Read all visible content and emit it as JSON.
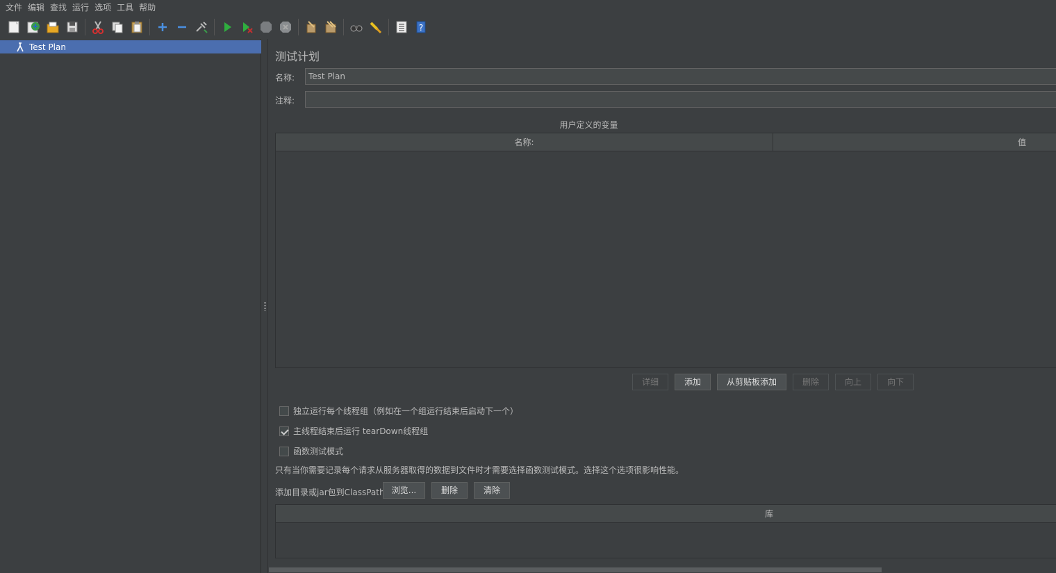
{
  "menu": [
    "文件",
    "编辑",
    "查找",
    "运行",
    "选项",
    "工具",
    "帮助"
  ],
  "toolbar": {
    "icons": [
      "new-icon",
      "templates-icon",
      "open-icon",
      "save-icon",
      "cut-icon",
      "copy-icon",
      "paste-icon",
      "expand-icon",
      "collapse-icon",
      "toggle-icon",
      "start-icon",
      "start-no-pause-icon",
      "stop-icon",
      "shutdown-icon",
      "clear-icon",
      "clear-all-icon",
      "search-icon",
      "reset-search-icon",
      "function-helper-icon",
      "help-icon"
    ]
  },
  "tree": {
    "selected_item": "Test Plan"
  },
  "main": {
    "title": "测试计划",
    "name_label": "名称:",
    "name_value": "Test Plan",
    "comment_label": "注释:",
    "comment_value": "",
    "variables_title": "用户定义的变量",
    "variables_columns": [
      "名称:",
      "值"
    ],
    "variables_rows": [],
    "buttons": {
      "detail": "详细",
      "add": "添加",
      "add_from_clipboard": "从剪贴板添加",
      "delete": "删除",
      "up": "向上",
      "down": "向下"
    },
    "options": [
      {
        "label": "独立运行每个线程组（例如在一个组运行结束后启动下一个）",
        "checked": false
      },
      {
        "label": "主线程结束后运行 tearDown线程组",
        "checked": true
      },
      {
        "label": "函数测试模式",
        "checked": false
      }
    ],
    "functional_note": "只有当你需要记录每个请求从服务器取得的数据到文件时才需要选择函数测试模式。选择这个选项很影响性能。",
    "classpath_label": "添加目录或jar包到ClassPath",
    "classpath_buttons": {
      "browse": "浏览...",
      "delete": "删除",
      "clear": "清除"
    },
    "library_column": "库"
  },
  "colors": {
    "background": "#3c3f41",
    "selection": "#4b6eaf",
    "text": "#bbbbbb"
  }
}
